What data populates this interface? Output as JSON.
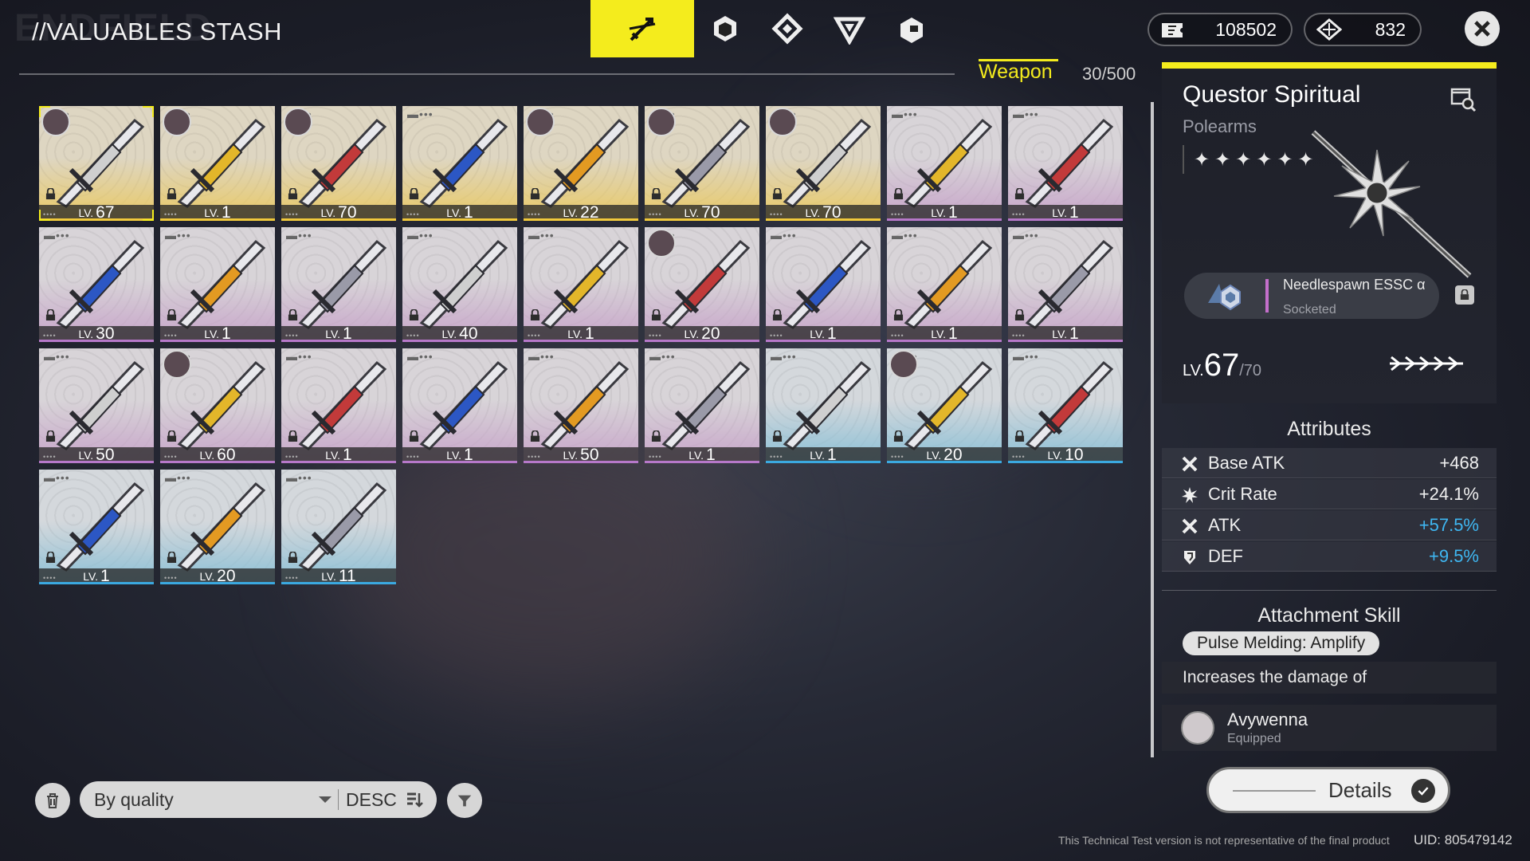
{
  "header": {
    "ghost_logo": "ENDFIELD",
    "title": "//VALUABLES STASH",
    "category_tabs": [
      {
        "name": "weapon-category",
        "icon": "sword-slash-icon",
        "active": true
      },
      {
        "name": "essence-category",
        "icon": "cube-icon",
        "active": false
      },
      {
        "name": "gear-category",
        "icon": "diamond-chip-icon",
        "active": false
      },
      {
        "name": "material-category",
        "icon": "triangle-gem-icon",
        "active": false
      },
      {
        "name": "misc-category",
        "icon": "box-tag-icon",
        "active": false
      }
    ],
    "currencies": [
      {
        "icon": "ticket-icon",
        "value": "108502"
      },
      {
        "icon": "origeometry-icon",
        "value": "832"
      }
    ]
  },
  "tab": {
    "label": "Weapon",
    "count": "30/500"
  },
  "accent_color": "#f4ec1d",
  "weapons": [
    {
      "level": "67",
      "rarity": "gold",
      "equipped": true,
      "selected": true,
      "icon": "polearm-icon"
    },
    {
      "level": "1",
      "rarity": "gold",
      "equipped": true,
      "icon": "curved-blade-icon"
    },
    {
      "level": "70",
      "rarity": "gold",
      "equipped": true,
      "icon": "hook-arts-unit-icon"
    },
    {
      "level": "1",
      "rarity": "gold",
      "equipped": false,
      "icon": "red-greatsword-icon"
    },
    {
      "level": "22",
      "rarity": "gold",
      "equipped": true,
      "icon": "gear-blade-icon"
    },
    {
      "level": "70",
      "rarity": "gold",
      "equipped": true,
      "icon": "red-sword-icon"
    },
    {
      "level": "70",
      "rarity": "gold",
      "equipped": true,
      "icon": "silver-blade-icon"
    },
    {
      "level": "1",
      "rarity": "purple",
      "equipped": false,
      "icon": "dark-sword-icon"
    },
    {
      "level": "1",
      "rarity": "purple",
      "equipped": false,
      "icon": "red-edge-sword-icon"
    },
    {
      "level": "30",
      "rarity": "purple",
      "equipped": false,
      "icon": "blue-gauntlet-icon"
    },
    {
      "level": "1",
      "rarity": "purple",
      "equipped": false,
      "icon": "red-gauntlet-icon"
    },
    {
      "level": "1",
      "rarity": "purple",
      "equipped": false,
      "icon": "red-gauntlet-icon"
    },
    {
      "level": "40",
      "rarity": "purple",
      "equipped": false,
      "icon": "staff-icon"
    },
    {
      "level": "1",
      "rarity": "purple",
      "equipped": false,
      "icon": "blue-sword-icon"
    },
    {
      "level": "20",
      "rarity": "purple",
      "equipped": true,
      "icon": "blue-gold-sword-icon"
    },
    {
      "level": "1",
      "rarity": "purple",
      "equipped": false,
      "icon": "blue-gold-sword-icon"
    },
    {
      "level": "1",
      "rarity": "purple",
      "equipped": false,
      "icon": "orange-cannon-icon"
    },
    {
      "level": "1",
      "rarity": "purple",
      "equipped": false,
      "icon": "orange-blade-icon"
    },
    {
      "level": "50",
      "rarity": "purple",
      "equipped": false,
      "icon": "orange-blade-icon"
    },
    {
      "level": "60",
      "rarity": "purple",
      "equipped": true,
      "icon": "white-blade-icon"
    },
    {
      "level": "1",
      "rarity": "purple",
      "equipped": false,
      "icon": "grey-sword-icon"
    },
    {
      "level": "1",
      "rarity": "purple",
      "equipped": false,
      "icon": "grey-sword-icon"
    },
    {
      "level": "50",
      "rarity": "purple",
      "equipped": false,
      "icon": "grey-sword-icon"
    },
    {
      "level": "1",
      "rarity": "purple",
      "equipped": false,
      "icon": "grey-sword-icon"
    },
    {
      "level": "1",
      "rarity": "blue",
      "equipped": false,
      "icon": "broad-sword-icon"
    },
    {
      "level": "20",
      "rarity": "blue",
      "equipped": true,
      "icon": "broad-sword-icon"
    },
    {
      "level": "10",
      "rarity": "blue",
      "equipped": false,
      "icon": "broad-sword-icon"
    },
    {
      "level": "1",
      "rarity": "blue",
      "equipped": false,
      "icon": "long-blade-icon"
    },
    {
      "level": "20",
      "rarity": "blue",
      "equipped": false,
      "icon": "long-blade-icon"
    },
    {
      "level": "11",
      "rarity": "blue",
      "equipped": false,
      "icon": "katana-icon"
    }
  ],
  "level_prefix": "LV.",
  "bottom_bar": {
    "sort_label": "By quality",
    "order_label": "DESC"
  },
  "detail": {
    "name": "Questor Spiritual",
    "type": "Polearms",
    "stars": 6,
    "essence": {
      "name": "Needlespawn ESSC α",
      "state": "Socketed"
    },
    "level_prefix": "LV.",
    "level": "67",
    "level_max": "/70",
    "attributes_title": "Attributes",
    "attributes": [
      {
        "icon": "crossed-swords-icon",
        "name": "Base ATK",
        "value": "+468",
        "boost": false
      },
      {
        "icon": "burst-icon",
        "name": "Crit Rate",
        "value": "+24.1%",
        "boost": false
      },
      {
        "icon": "crossed-swords-icon",
        "name": "ATK",
        "value": "+57.5%",
        "boost": true
      },
      {
        "icon": "shield-icon",
        "name": "DEF",
        "value": "+9.5%",
        "boost": true
      }
    ],
    "skill_title": "Attachment Skill",
    "skill_name": "Pulse Melding: Amplify",
    "skill_desc": "Increases the damage of",
    "owner": {
      "name": "Avywenna",
      "state": "Equipped"
    },
    "details_button": "Details"
  },
  "footer": {
    "note": "This Technical Test version is not representative of the final product",
    "uid": "UID: 805479142"
  }
}
